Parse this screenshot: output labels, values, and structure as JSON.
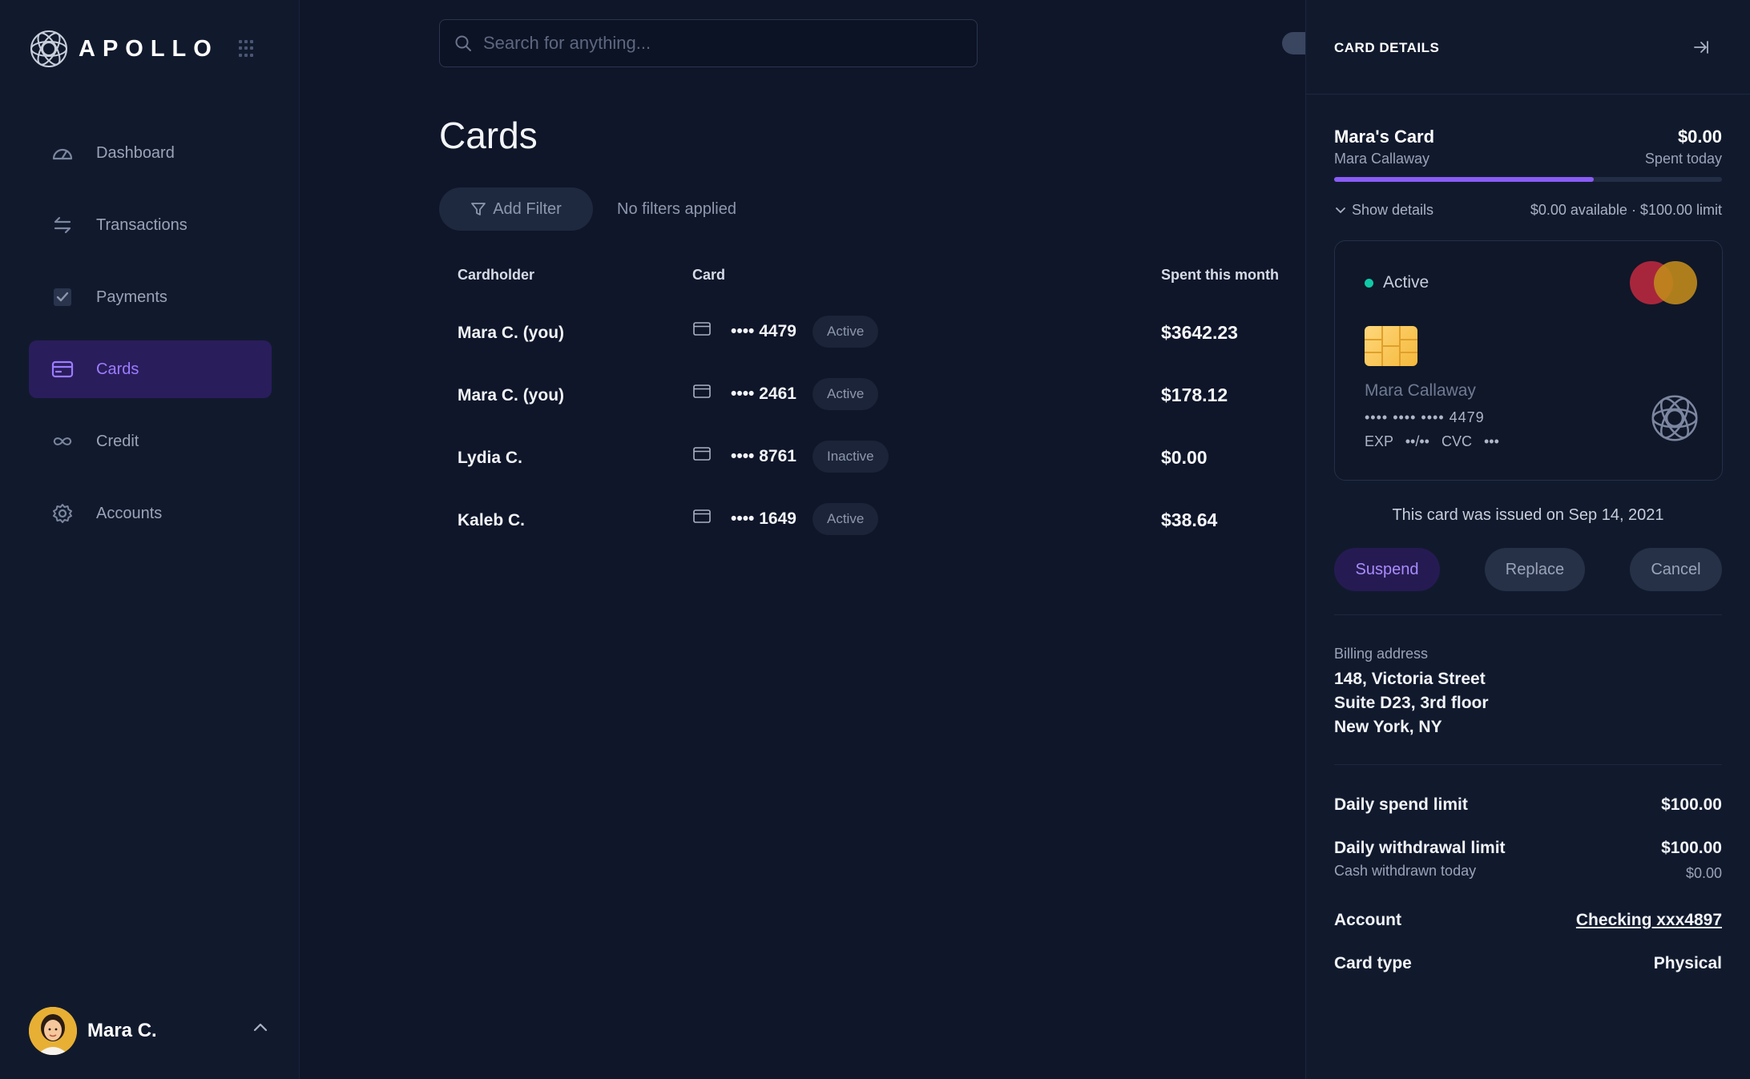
{
  "app": {
    "name": "APOLLO"
  },
  "sidebar": {
    "items": [
      {
        "label": "Dashboard",
        "icon": "dashboard-gauge-icon",
        "active": false
      },
      {
        "label": "Transactions",
        "icon": "transfer-arrows-icon",
        "active": false
      },
      {
        "label": "Payments",
        "icon": "check-icon",
        "active": false
      },
      {
        "label": "Cards",
        "icon": "credit-card-icon",
        "active": true
      },
      {
        "label": "Credit",
        "icon": "infinity-icon",
        "active": false
      },
      {
        "label": "Accounts",
        "icon": "gear-icon",
        "active": false
      }
    ],
    "user": {
      "name": "Mara C."
    }
  },
  "search": {
    "placeholder": "Search for anything..."
  },
  "main": {
    "title": "Cards",
    "filter": {
      "button_label": "Add Filter",
      "status": "No filters applied"
    },
    "table": {
      "headers": {
        "cardholder": "Cardholder",
        "card": "Card",
        "spent": "Spent this month"
      },
      "rows": [
        {
          "cardholder": "Mara C. (you)",
          "last4": "•••• 4479",
          "status": "Active",
          "spent": "$3642.23"
        },
        {
          "cardholder": "Mara C. (you)",
          "last4": "•••• 2461",
          "status": "Active",
          "spent": "$178.12"
        },
        {
          "cardholder": "Lydia C.",
          "last4": "•••• 8761",
          "status": "Inactive",
          "spent": "$0.00"
        },
        {
          "cardholder": "Kaleb C.",
          "last4": "•••• 1649",
          "status": "Active",
          "spent": "$38.64"
        }
      ]
    }
  },
  "details": {
    "title": "CARD DETAILS",
    "card_name": "Mara's Card",
    "holder": "Mara Callaway",
    "spent_amount": "$0.00",
    "spent_label": "Spent today",
    "progress_fraction": 0.67,
    "show_details": "Show details",
    "availability": "$0.00 available · $100.00 limit",
    "card_visual": {
      "status": "Active",
      "name": "Mara Callaway",
      "number": "•••• •••• •••• 4479",
      "exp_label": "EXP",
      "exp_value": "••/••",
      "cvc_label": "CVC",
      "cvc_value": "•••"
    },
    "issued_text": "This card was issued on Sep 14, 2021",
    "actions": {
      "suspend": "Suspend",
      "replace": "Replace",
      "cancel": "Cancel"
    },
    "billing": {
      "label": "Billing address",
      "lines": [
        "148, Victoria Street",
        "Suite D23, 3rd floor",
        "New York, NY"
      ]
    },
    "limits": {
      "daily_spend_label": "Daily spend limit",
      "daily_spend_value": "$100.00",
      "daily_withdrawal_label": "Daily withdrawal limit",
      "daily_withdrawal_value": "$100.00",
      "cash_withdrawn_label": "Cash withdrawn today",
      "cash_withdrawn_value": "$0.00",
      "account_label": "Account",
      "account_value": "Checking xxx4897",
      "card_type_label": "Card type",
      "card_type_value": "Physical"
    }
  },
  "colors": {
    "accent": "#8a5cf6",
    "active_dot": "#10c9a6",
    "background": "#0f1629",
    "panel": "#111a2d"
  }
}
